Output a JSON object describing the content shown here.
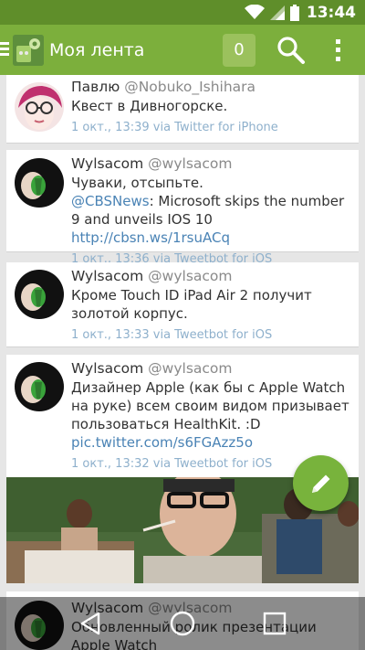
{
  "status_bar": {
    "time": "13:44"
  },
  "app_bar": {
    "title": "Моя лента",
    "badge_count": "0"
  },
  "tweets": [
    {
      "name": "Павлю",
      "handle": "@Nobuko_Ishihara",
      "text": "Квест в Дивногорске.",
      "meta": "1 окт., 13:39 via Twitter for iPhone"
    },
    {
      "name": "Wylsacom",
      "handle": "@wylsacom",
      "text_parts": [
        "Чуваки, отсыпьте.",
        "@CBSNews",
        ": Microsoft skips the number 9 and unveils IOS 10 ",
        "http://cbsn.ws/1rsuACq"
      ],
      "meta": "1 окт., 13:36 via Tweetbot for iOS"
    },
    {
      "name": "Wylsacom",
      "handle": "@wylsacom",
      "text": "Кроме Touch ID iPad Air 2 получит золотой корпус.",
      "meta": "1 окт., 13:33 via Tweetbot for iOS"
    },
    {
      "name": "Wylsacom",
      "handle": "@wylsacom",
      "text_parts": [
        "Дизайнер Apple (как бы с Apple Watch на руке) всем своим видом призывает пользоваться HealthKit. :D ",
        "pic.twitter.com/s6FGAzz5o"
      ],
      "meta": "1 окт., 13:32 via Tweetbot for iOS"
    },
    {
      "name": "Wylsacom",
      "handle": "@wylsacom",
      "text": "Обновленный ролик презентации Apple Watch"
    }
  ],
  "icons": {
    "menu": "hamburger-icon",
    "search": "search-icon",
    "overflow": "overflow-menu-icon",
    "fab": "pencil-icon",
    "back": "back-icon",
    "home": "home-icon",
    "recents": "recents-icon"
  },
  "colors": {
    "status_bar": "#5f8e2a",
    "app_bar": "#7caf3c",
    "link": "#4a83b5",
    "meta": "#8eb0cc",
    "fab": "#78b33c"
  }
}
